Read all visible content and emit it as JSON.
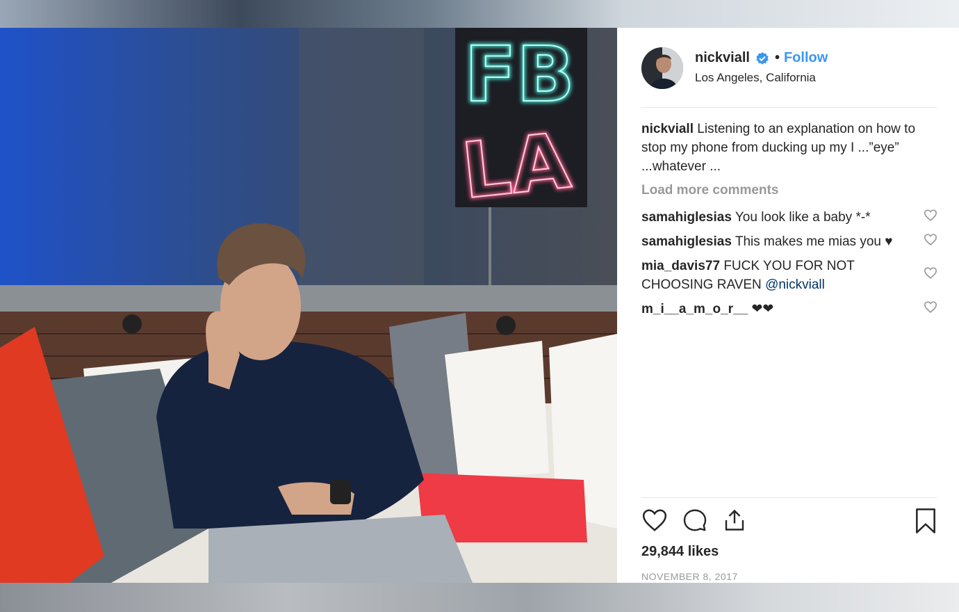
{
  "header": {
    "username": "nickviall",
    "dot": "•",
    "follow_label": "Follow",
    "location": "Los Angeles, California"
  },
  "caption": {
    "username": "nickviall",
    "text": "Listening to an explanation on how to stop my phone from ducking up my I ...”eye” ...whatever ..."
  },
  "load_more_label": "Load more comments",
  "comments": [
    {
      "username": "samahiglesias",
      "text": "You look like a baby *-*"
    },
    {
      "username": "samahiglesias",
      "text": "This makes me mias you ♥"
    },
    {
      "username": "mia_davis77",
      "text": "FUCK YOU FOR NOT CHOOSING RAVEN ",
      "mention": "@nickviall"
    },
    {
      "username": "m_i__a_m_o_r__",
      "text": "❤❤"
    }
  ],
  "likes": "29,844 likes",
  "date": "NOVEMBER 8, 2017",
  "photo": {
    "neon_top": "FB",
    "neon_bottom": "LA",
    "neon_top_color": "#4ef3e0",
    "neon_bottom_color": "#ff5a8a"
  },
  "colors": {
    "link": "#3897f0",
    "text": "#262626",
    "muted": "#999999"
  },
  "icons": [
    "verified-badge-icon",
    "heart-icon",
    "comment-icon",
    "share-icon",
    "bookmark-icon"
  ]
}
